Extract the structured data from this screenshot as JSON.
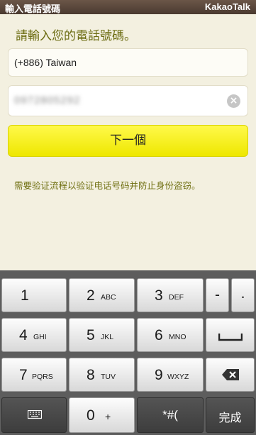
{
  "titlebar": {
    "title": "輸入電話號碼",
    "app": "KakaoTalk"
  },
  "heading": "請輸入您的電話號碼。",
  "country_field": {
    "value": "(+886) Taiwan"
  },
  "phone_field": {
    "value": "0972805292"
  },
  "next_button": {
    "label": "下一個"
  },
  "notice": "需要验证流程以验证电话号码并防止身份盗窃。",
  "keyboard": {
    "keys": [
      {
        "num": "1",
        "letters": ""
      },
      {
        "num": "2",
        "letters": "ABC"
      },
      {
        "num": "3",
        "letters": "DEF"
      },
      {
        "num": "4",
        "letters": "GHI"
      },
      {
        "num": "5",
        "letters": "JKL"
      },
      {
        "num": "6",
        "letters": "MNO"
      },
      {
        "num": "7",
        "letters": "PQRS"
      },
      {
        "num": "8",
        "letters": "TUV"
      },
      {
        "num": "9",
        "letters": "WXYZ"
      },
      {
        "num": "0",
        "letters": "+"
      }
    ],
    "dash": "-",
    "dot": ".",
    "symbols": "*#(",
    "done": "完成"
  }
}
